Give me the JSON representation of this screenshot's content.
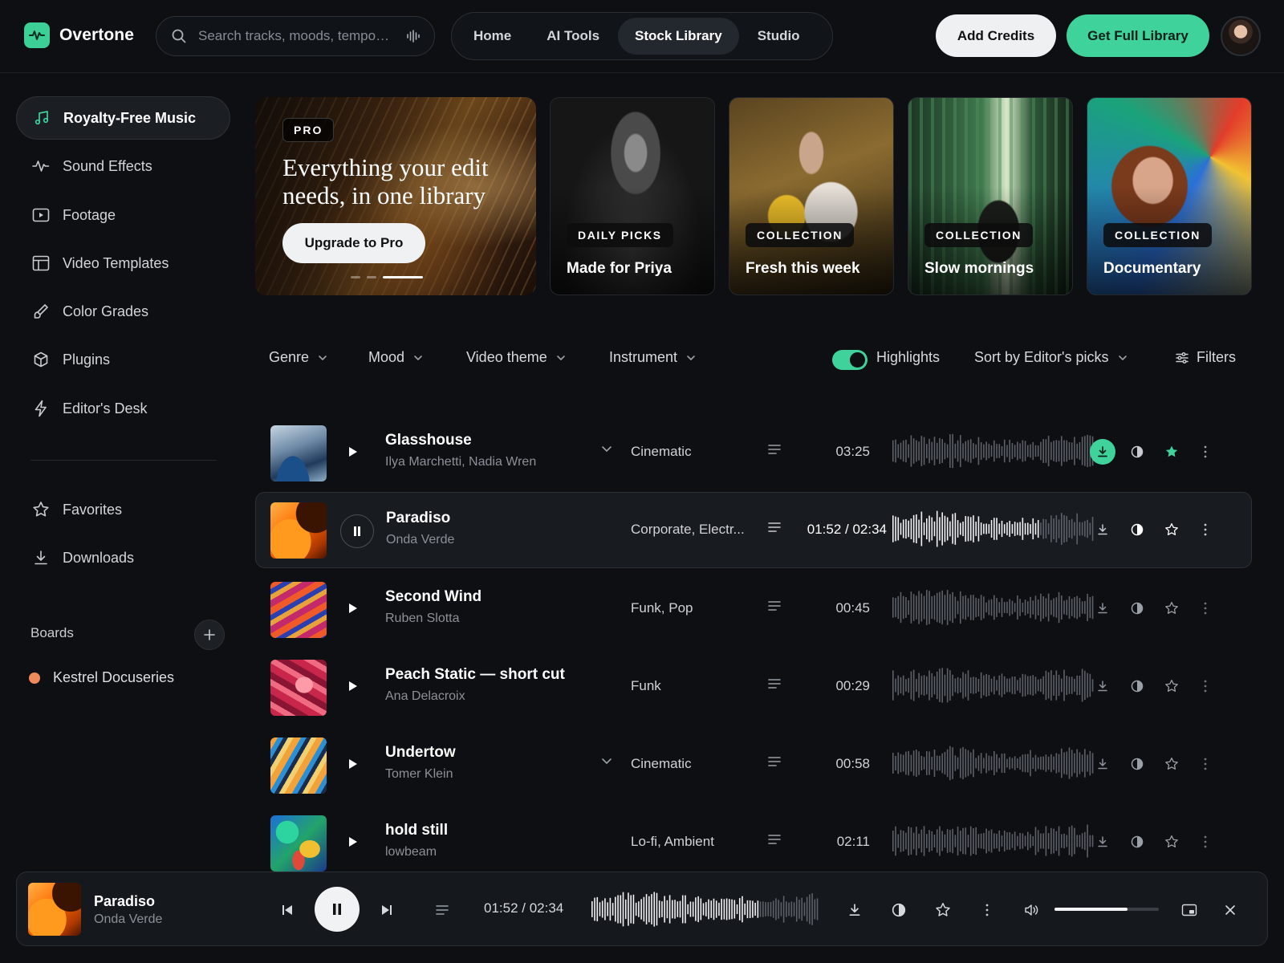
{
  "app": {
    "name": "Overtone",
    "accent": "#3fd29b"
  },
  "search": {
    "placeholder": "Search tracks, moods, tempo…"
  },
  "nav": {
    "tabs": [
      "Home",
      "AI Tools",
      "Stock Library",
      "Studio"
    ],
    "active": "Stock Library"
  },
  "header": {
    "add_credits": "Add Credits",
    "get_full_library": "Get Full Library"
  },
  "sidebar": {
    "items": [
      {
        "label": "Royalty-Free Music",
        "icon": "music-note-icon",
        "active": true
      },
      {
        "label": "Sound Effects",
        "icon": "waveform-icon"
      },
      {
        "label": "Footage",
        "icon": "video-play-icon"
      },
      {
        "label": "Video Templates",
        "icon": "layout-template-icon"
      },
      {
        "label": "Color Grades",
        "icon": "brush-icon"
      },
      {
        "label": "Plugins",
        "icon": "cube-icon"
      },
      {
        "label": "Editor's Desk",
        "icon": "lightning-icon"
      }
    ],
    "secondary": [
      {
        "label": "Favorites",
        "icon": "star-icon"
      },
      {
        "label": "Downloads",
        "icon": "download-icon"
      }
    ],
    "boards_title": "Boards",
    "boards": [
      {
        "label": "Kestrel Docuseries",
        "color": "#f08a5d"
      }
    ]
  },
  "hero": {
    "badge": "PRO",
    "title": "Everything your edit needs, in one library",
    "button": "Upgrade to Pro",
    "slides": 3,
    "active_slide": 3
  },
  "cards": [
    {
      "tag": "DAILY PICKS",
      "title": "Made for Priya"
    },
    {
      "tag": "COLLECTION",
      "title": "Fresh this week"
    },
    {
      "tag": "COLLECTION",
      "title": "Slow mornings"
    },
    {
      "tag": "COLLECTION",
      "title": "Documentary"
    }
  ],
  "filters": {
    "genre": "Genre",
    "mood": "Mood",
    "video_theme": "Video theme",
    "instrument": "Instrument",
    "highlights": "Highlights",
    "highlights_on": true,
    "sort": "Sort by Editor's picks",
    "filters": "Filters"
  },
  "tracks": [
    {
      "title": "Glasshouse",
      "artist": "Ilya Marchetti, Nadia Wren",
      "genre": "Cinematic",
      "time": "03:25",
      "expandable": true,
      "downloaded": true,
      "favorited": true
    },
    {
      "title": "Paradiso",
      "artist": "Onda Verde",
      "genre": "Corporate, Electr...",
      "time": "01:52 / 02:34",
      "playing": true,
      "progress": 0.73
    },
    {
      "title": "Second Wind",
      "artist": "Ruben Slotta",
      "genre": "Funk, Pop",
      "time": "00:45"
    },
    {
      "title": "Peach Static — short cut",
      "artist": "Ana Delacroix",
      "genre": "Funk",
      "time": "00:29"
    },
    {
      "title": "Undertow",
      "artist": "Tomer Klein",
      "genre": "Cinematic",
      "time": "00:58",
      "expandable": true
    },
    {
      "title": "hold still",
      "artist": "lowbeam",
      "genre": "Lo-fi, Ambient",
      "time": "02:11"
    }
  ],
  "player": {
    "title": "Paradiso",
    "artist": "Onda Verde",
    "time": "01:52 / 02:34",
    "progress": 0.73,
    "volume": 0.7
  }
}
